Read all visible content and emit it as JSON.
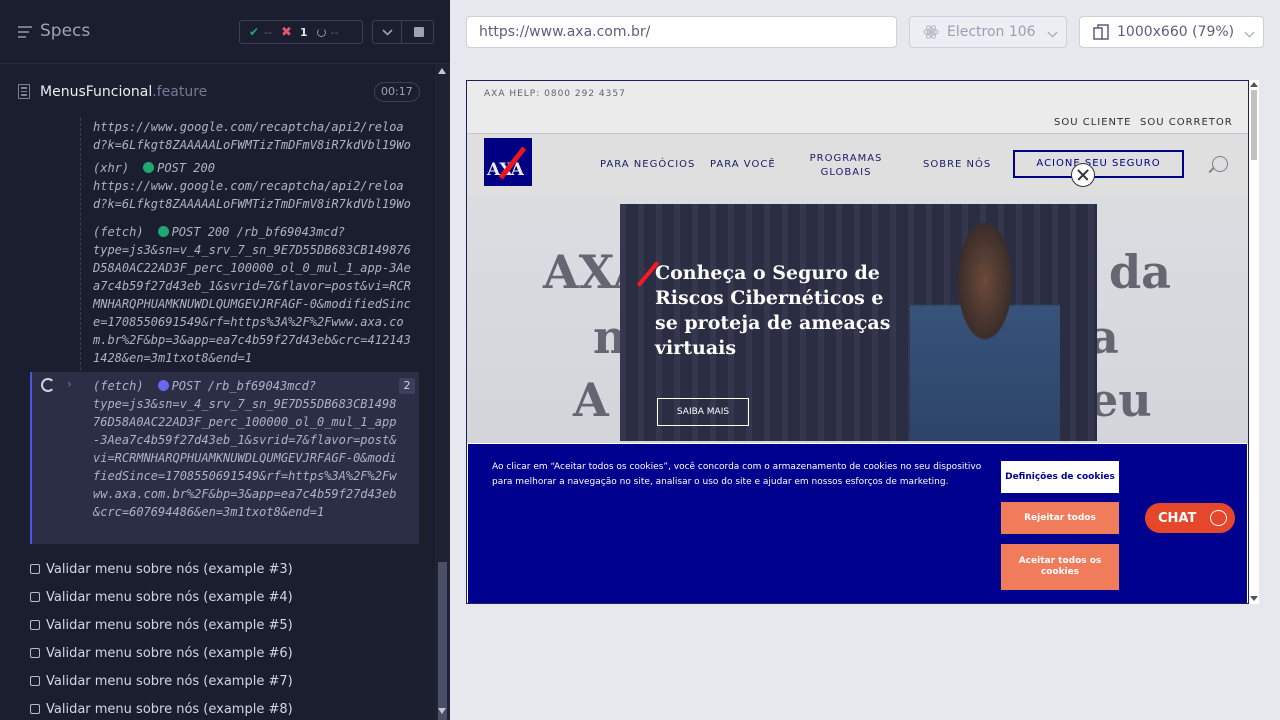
{
  "specs": {
    "title": "Specs"
  },
  "stats": {
    "passed": "--",
    "failed": "1",
    "pending": "--"
  },
  "file": {
    "name": "MenusFuncional",
    "ext": ".feature",
    "duration": "00:17"
  },
  "log": [
    {
      "text": "https://www.google.com/recaptcha/api2/reload?k=6Lfkgt8ZAAAAALoFWMTizTmDFmV8iR7kdVbl19Wo"
    },
    {
      "type": "(xhr)",
      "status": "POST 200",
      "text": "https://www.google.com/recaptcha/api2/reload?k=6Lfkgt8ZAAAAALoFWMTizTmDFmV8iR7kdVbl19Wo"
    },
    {
      "type": "(fetch)",
      "status": "POST 200 /rb_bf69043mcd?",
      "text": "type=js3&sn=v_4_srv_7_sn_9E7D55DB683CB149876D58A0AC22AD3F_perc_100000_ol_0_mul_1_app-3Aea7c4b59f27d43eb_1&svrid=7&flavor=post&vi=RCRMNHARQPHUAMKNUWDLQUMGEVJRFAGF-0&modifiedSince=1708550691549&rf=https%3A%2F%2Fwww.axa.com.br%2F&bp=3&app=ea7c4b59f27d43eb&crc=4121431428&en=3m1txot8&end=1"
    },
    {
      "type": "(fetch)",
      "status": "POST /rb_bf69043mcd?",
      "count": "2",
      "text": "type=js3&sn=v_4_srv_7_sn_9E7D55DB683CB149876D58A0AC22AD3F_perc_100000_ol_0_mul_1_app-3Aea7c4b59f27d43eb_1&svrid=7&flavor=post&vi=RCRMNHARQPHUAMKNUWDLQUMGEVJRFAGF-0&modifiedSince=1708550691549&rf=https%3A%2F%2Fwww.axa.com.br%2F&bp=3&app=ea7c4b59f27d43eb&crc=607694486&en=3m1txot8&end=1"
    }
  ],
  "tests": [
    "Validar menu sobre nós (example #3)",
    "Validar menu sobre nós (example #4)",
    "Validar menu sobre nós (example #5)",
    "Validar menu sobre nós (example #6)",
    "Validar menu sobre nós (example #7)",
    "Validar menu sobre nós (example #8)"
  ],
  "url": "https://www.axa.com.br/",
  "browser": "Electron 106",
  "viewport": "1000x660  (79%)",
  "site": {
    "help": "AXA HELP: 0800 292 4357",
    "top_links": [
      "SOU CLIENTE",
      "SOU CORRETOR"
    ],
    "logo": "AXA",
    "nav": [
      "PARA NEGÓCIOS",
      "PARA VOCÊ",
      "PROGRAMAS GLOBAIS",
      "SOBRE NÓS"
    ],
    "cta": "ACIONE SEU SEGURO",
    "hero_bg": [
      "AXA",
      "da",
      "n",
      "a",
      "A",
      "eu"
    ],
    "modal_title": "Conheça o Seguro de Riscos Cibernéticos e se proteja de ameaças virtuais",
    "modal_button": "SAIBA MAIS",
    "cookie_text": "Ao clicar em “Aceitar todos os cookies”, você concorda com o armazenamento de cookies no seu dispositivo para melhorar a navegação no site, analisar o uso do site e ajudar em nossos esforços de marketing.",
    "cookie_settings": "Definições de cookies",
    "cookie_reject": "Rejeitar todos",
    "cookie_accept": "Aceitar todos os cookies",
    "chat": "CHAT"
  },
  "colors": {
    "accent": "#00008f",
    "fail": "#e45770",
    "pass": "#1fa971",
    "cookie_btn": "#f07c5c"
  }
}
